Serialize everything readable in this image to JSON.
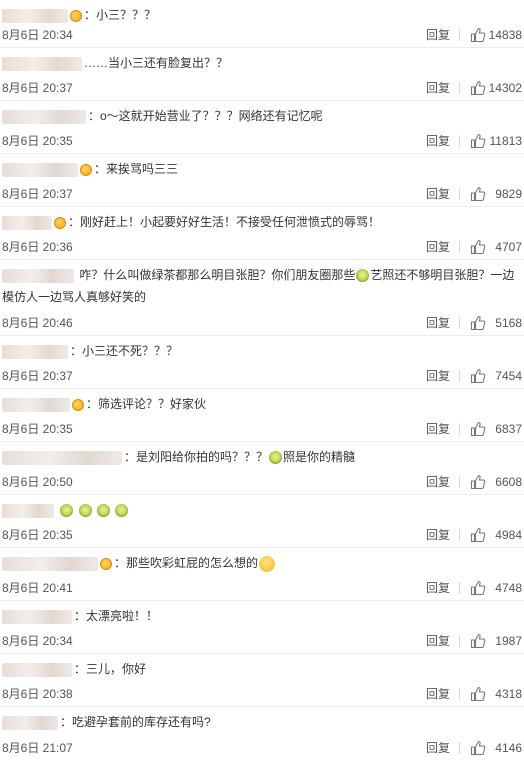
{
  "reply_label": "回复",
  "comments": [
    {
      "text": "：小三？？？",
      "time": "8月6日 20:34",
      "likes": "14838"
    },
    {
      "text": "……当小三还有脸复出？？",
      "time": "8月6日 20:37",
      "likes": "14302"
    },
    {
      "text": "：o～这就开始营业了？？？网络还有记忆呢",
      "time": "8月6日 20:35",
      "likes": "11813"
    },
    {
      "text": "：来挨骂吗三三",
      "time": "8月6日 20:37",
      "likes": "9829"
    },
    {
      "text": "：刚好赶上！小起要好好生活！不接受任何泄愤式的辱骂！",
      "time": "8月6日 20:36",
      "likes": "4707"
    },
    {
      "text_a": "咋？什么叫做绿茶都那么明目张胆？你们朋友圈那些",
      "text_b": "艺照还不够明目张胆？一边模仿人一边骂人真够好笑的",
      "time": "8月6日 20:46",
      "likes": "5168"
    },
    {
      "text": "：小三还不死？？？",
      "time": "8月6日 20:37",
      "likes": "7454"
    },
    {
      "text": "：筛选评论？？好家伙",
      "time": "8月6日 20:35",
      "likes": "6837"
    },
    {
      "text_a": "：是刘阳给你拍的吗？？？",
      "text_b": "照是你的精髓",
      "time": "8月6日 20:50",
      "likes": "6608"
    },
    {
      "text": "",
      "time": "8月6日 20:35",
      "likes": "4984"
    },
    {
      "text": "：那些吹彩虹屁的怎么想的",
      "time": "8月6日 20:41",
      "likes": "4748"
    },
    {
      "text": "：太漂亮啦！！",
      "time": "8月6日 20:34",
      "likes": "1987"
    },
    {
      "text": "：三儿，你好",
      "time": "8月6日 20:38",
      "likes": "4318"
    },
    {
      "text": "：吃避孕套前的库存还有吗?",
      "time": "8月6日 21:07",
      "likes": "4146"
    }
  ]
}
